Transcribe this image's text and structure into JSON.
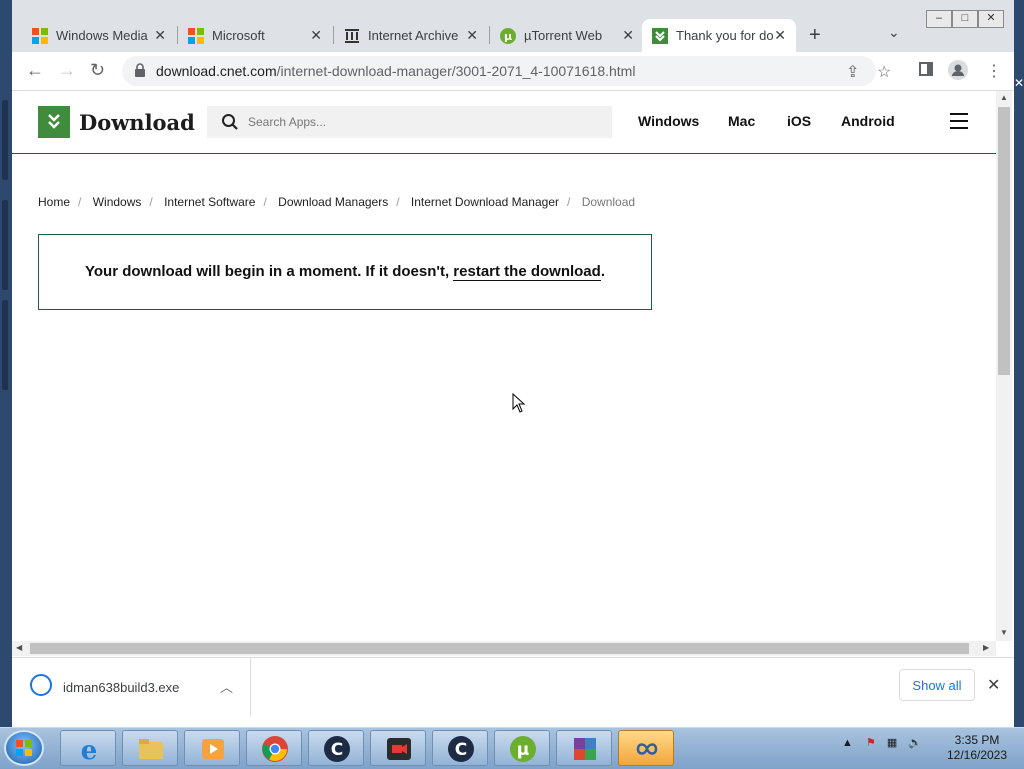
{
  "browser": {
    "tabs": [
      {
        "title": "Windows Media",
        "favicon": "microsoft-logo",
        "active": false
      },
      {
        "title": "Microsoft",
        "favicon": "microsoft-logo",
        "active": false
      },
      {
        "title": "Internet Archive",
        "favicon": "archive-icon",
        "active": false
      },
      {
        "title": "µTorrent Web",
        "favicon": "utorrent-icon",
        "active": false
      },
      {
        "title": "Thank you for do",
        "favicon": "download-logo",
        "active": true
      }
    ],
    "address": {
      "domain": "download.cnet.com",
      "path": "/internet-download-manager/3001-2071_4-10071618.html"
    }
  },
  "site": {
    "logo_text": "Download",
    "search_placeholder": "Search Apps...",
    "nav": [
      "Windows",
      "Mac",
      "iOS",
      "Android"
    ]
  },
  "breadcrumb": [
    "Home",
    "Windows",
    "Internet Software",
    "Download Managers",
    "Internet Download Manager",
    "Download"
  ],
  "notice": {
    "text": "Your download will begin in a moment. If it doesn't, ",
    "link": "restart the download",
    "end": "."
  },
  "downloads": {
    "file": "idman638build3.exe",
    "show_all": "Show all"
  },
  "taskbar": {
    "time": "3:35 PM",
    "date": "12/16/2023"
  },
  "colors": {
    "brand_green": "#3f8c3c",
    "header_rule": "#1d5d41",
    "link_blue": "#1a73e8"
  }
}
